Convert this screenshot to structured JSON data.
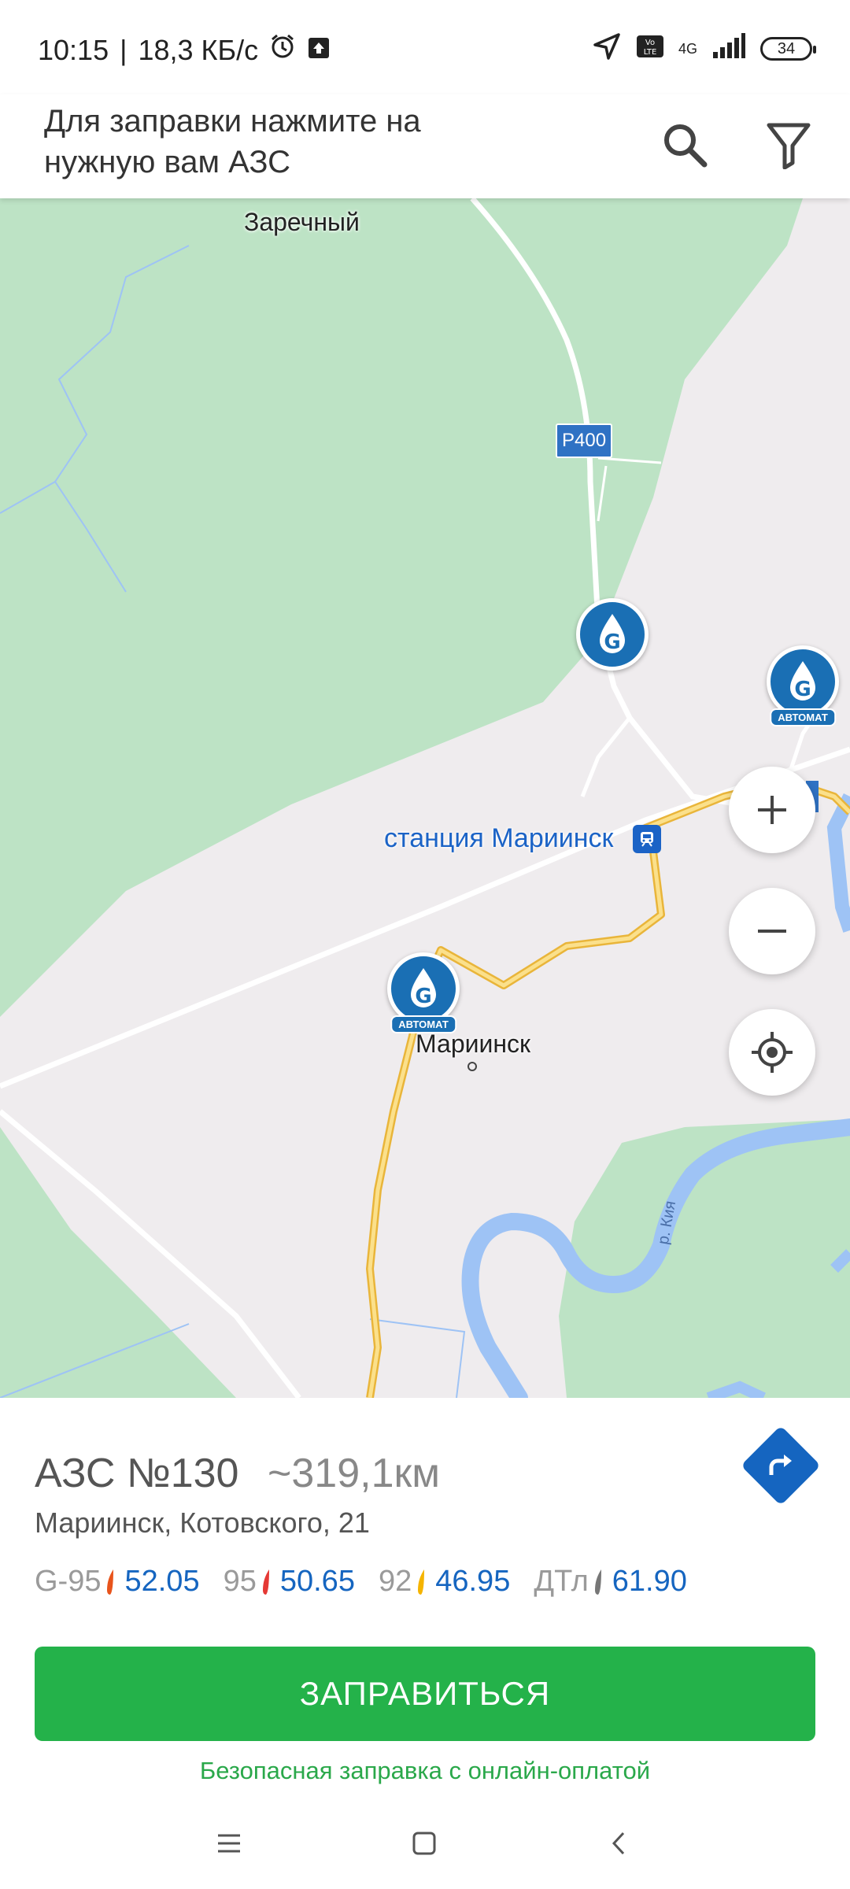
{
  "status_bar": {
    "time": "10:15",
    "separator": "|",
    "speed": "18,3 КБ/с",
    "network": "4G",
    "battery": "34",
    "alarm_icon": "alarm-icon",
    "upload_icon": "upload-icon",
    "location_icon": "location-arrow-icon",
    "volte_label": "Vo LTE"
  },
  "header": {
    "title": "Для заправки нажмите на нужную вам АЗС",
    "search_icon": "search-icon",
    "filter_icon": "filter-icon"
  },
  "map": {
    "labels": {
      "village": "Заречный",
      "road": "Р400",
      "station": "станция Мариинск",
      "town": "Мариинск",
      "river": "р. Кия"
    },
    "pins": [
      {
        "name": "gas-station-pin",
        "badge": ""
      },
      {
        "name": "gas-station-pin-automat",
        "badge": "АВТОМАТ"
      },
      {
        "name": "gas-station-pin-automat",
        "badge": "АВТОМАТ"
      }
    ],
    "controls": {
      "zoom_in": "+",
      "zoom_out": "−",
      "locate_icon": "my-location-icon"
    },
    "colors": {
      "forest": "#bde3c5",
      "land": "#efecee",
      "river": "#9ec3f5",
      "major_road": "#f6c84c",
      "minor_road": "#ffffff"
    }
  },
  "station": {
    "name": "АЗС №130",
    "distance": "~319,1км",
    "address": "Мариинск, Котовского, 21",
    "route_icon": "route-turn-icon",
    "fuels": [
      {
        "label": "G-95",
        "price": "52.05",
        "color": "#e8541c"
      },
      {
        "label": "95",
        "price": "50.65",
        "color": "#e53935"
      },
      {
        "label": "92",
        "price": "46.95",
        "color": "#f5b400"
      },
      {
        "label": "ДТл",
        "price": "61.90",
        "color": "#777777"
      }
    ],
    "cta": "ЗАПРАВИТЬСЯ",
    "cta_note": "Безопасная заправка с онлайн-оплатой"
  },
  "nav": {
    "menu_icon": "menu-icon",
    "home_icon": "home-icon",
    "back_icon": "back-icon"
  },
  "brand_colors": {
    "blue": "#1565c0",
    "green": "#24b24a"
  }
}
